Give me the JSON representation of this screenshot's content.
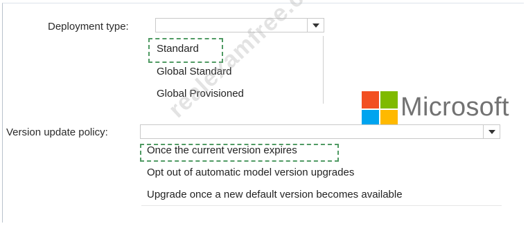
{
  "deployment": {
    "label": "Deployment type:",
    "selected": "",
    "options": [
      "Standard",
      "Global Standard",
      "Global Provisioned"
    ]
  },
  "version_policy": {
    "label": "Version update policy:",
    "selected": "",
    "options": [
      "Once the current version expires",
      "Opt out of automatic model version upgrades",
      "Upgrade once a new default version becomes available"
    ]
  },
  "logo": {
    "text": "Microsoft",
    "colors": [
      "#f25022",
      "#7fba00",
      "#00a4ef",
      "#ffb900"
    ]
  },
  "watermark": {
    "text": "realexamfree.com"
  },
  "colors": {
    "highlight": "#4f9a63"
  }
}
